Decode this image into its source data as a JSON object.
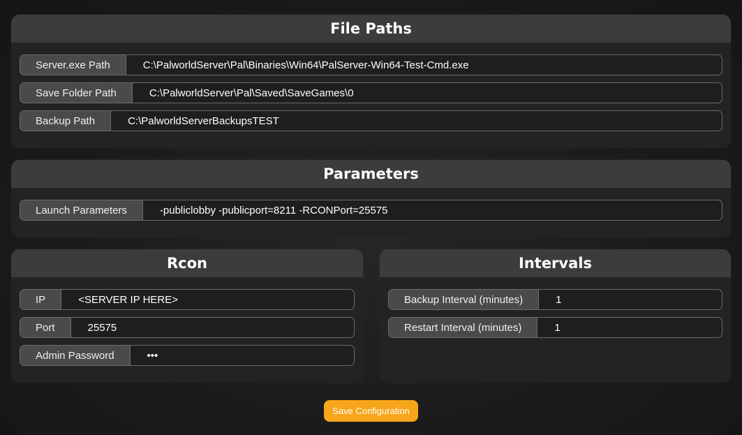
{
  "file_paths": {
    "title": "File Paths",
    "rows": [
      {
        "label": "Server.exe Path",
        "value": "C:\\PalworldServer\\Pal\\Binaries\\Win64\\PalServer-Win64-Test-Cmd.exe"
      },
      {
        "label": "Save Folder Path",
        "value": "C:\\PalworldServer\\Pal\\Saved\\SaveGames\\0"
      },
      {
        "label": "Backup Path",
        "value": "C:\\PalworldServerBackupsTEST"
      }
    ]
  },
  "parameters": {
    "title": "Parameters",
    "rows": [
      {
        "label": "Launch Parameters",
        "value": "-publiclobby -publicport=8211 -RCONPort=25575"
      }
    ]
  },
  "rcon": {
    "title": "Rcon",
    "rows": [
      {
        "label": "IP",
        "value": "<SERVER IP HERE>"
      },
      {
        "label": "Port",
        "value": "25575"
      },
      {
        "label": "Admin Password",
        "value": "•••"
      }
    ]
  },
  "intervals": {
    "title": "Intervals",
    "rows": [
      {
        "label": "Backup Interval (minutes)",
        "value": "1"
      },
      {
        "label": "Restart Interval (minutes)",
        "value": "1"
      }
    ]
  },
  "save_button": {
    "label": "Save Configuration"
  },
  "colors": {
    "accent": "#f7a51a",
    "panel": "#232323",
    "header": "#3c3c3c"
  }
}
